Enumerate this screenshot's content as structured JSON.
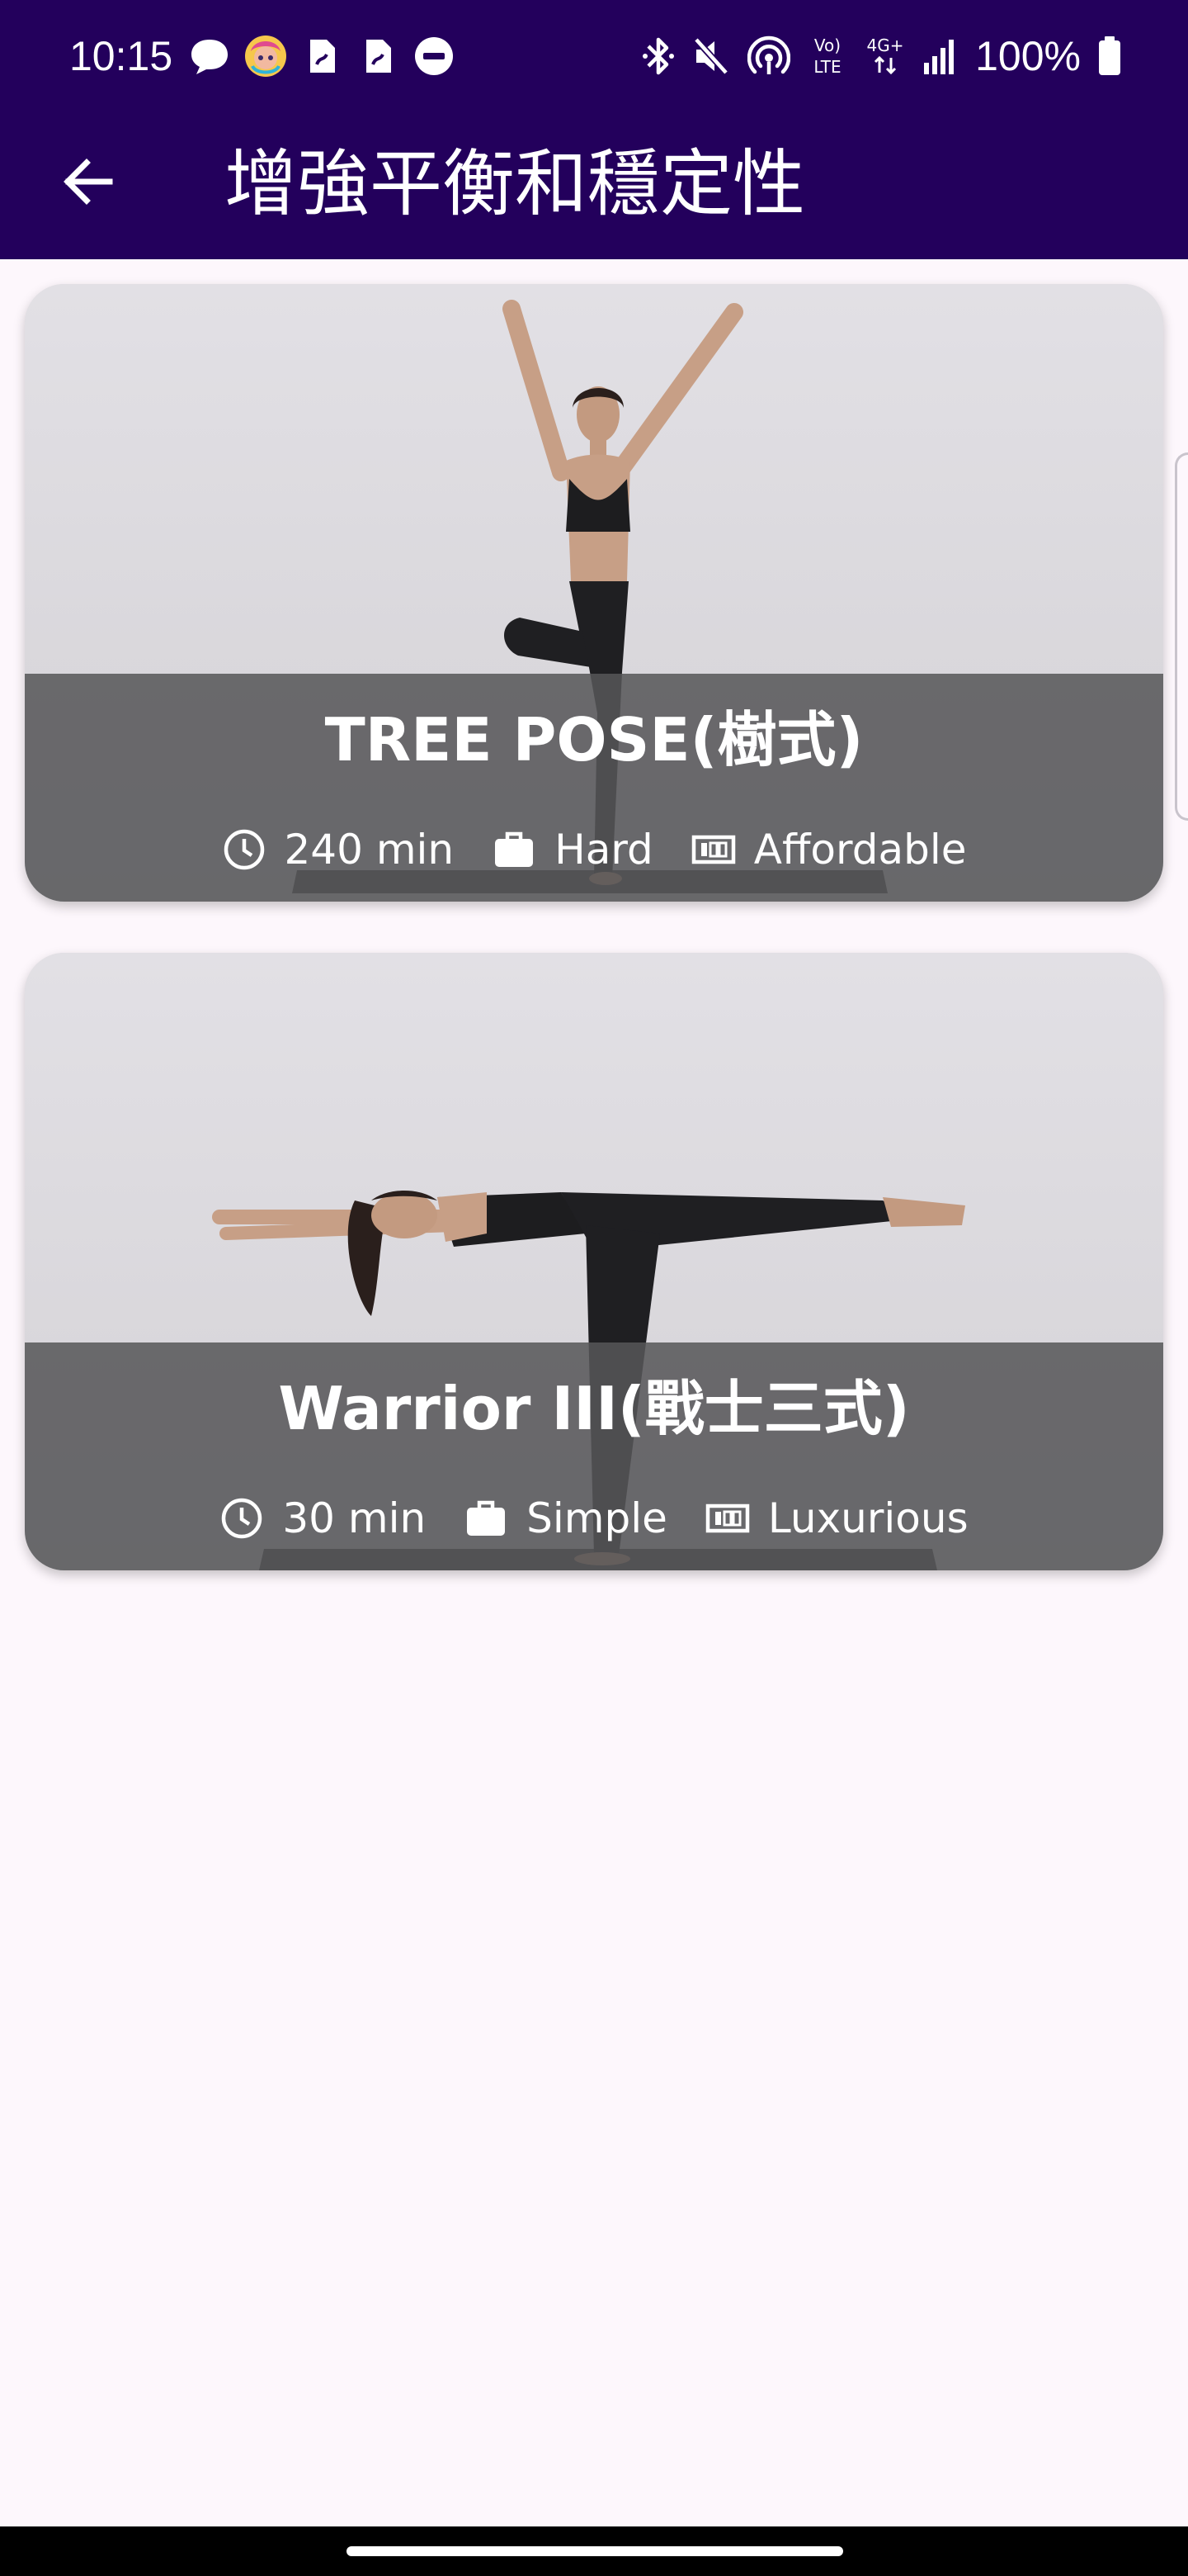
{
  "status_bar": {
    "time": "10:15",
    "notification_icons": [
      "chat-bubble-icon",
      "avatar-badge-icon",
      "document-icon",
      "document-icon",
      "do-not-disturb-icon"
    ],
    "system_icons": [
      "bluetooth-icon",
      "mute-icon",
      "hotspot-icon",
      "volte-icon",
      "4g-icon",
      "signal-icon"
    ],
    "battery": "100%"
  },
  "app_bar": {
    "back_icon": "arrow-back-icon",
    "title": "增強平衡和穩定性"
  },
  "cards": [
    {
      "title": "TREE POSE(樹式)",
      "duration": "240 min",
      "complexity": "Hard",
      "affordability": "Affordable",
      "duration_icon": "clock-icon",
      "complexity_icon": "briefcase-icon",
      "affordability_icon": "money-icon"
    },
    {
      "title": "Warrior III(戰士三式)",
      "duration": "30 min",
      "complexity": "Simple",
      "affordability": "Luxurious",
      "duration_icon": "clock-icon",
      "complexity_icon": "briefcase-icon",
      "affordability_icon": "money-icon"
    }
  ],
  "colors": {
    "app_bar": "#23005c",
    "background": "#fdf7fc",
    "overlay": "#565658",
    "text_on_dark": "#ffffff"
  }
}
